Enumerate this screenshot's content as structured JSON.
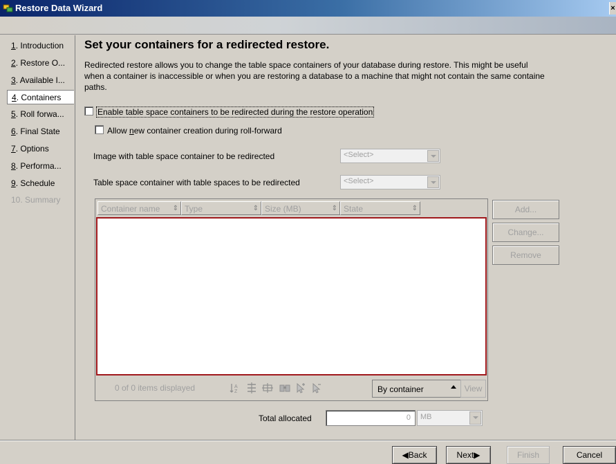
{
  "window": {
    "title": "Restore Data Wizard",
    "close_label": "×"
  },
  "steps": [
    {
      "label": "1. Introduction",
      "key": "1",
      "rest": ". Introduction",
      "state": "normal"
    },
    {
      "label": "2. Restore O...",
      "key": "2",
      "rest": ". Restore O...",
      "state": "normal"
    },
    {
      "label": "3. Available I...",
      "key": "3",
      "rest": ". Available I...",
      "state": "normal"
    },
    {
      "label": "4. Containers",
      "key": "4",
      "rest": ". Containers",
      "state": "active"
    },
    {
      "label": "5. Roll forwa...",
      "key": "5",
      "rest": ". Roll forwa...",
      "state": "normal"
    },
    {
      "label": "6. Final State",
      "key": "6",
      "rest": ". Final State",
      "state": "normal"
    },
    {
      "label": "7. Options",
      "key": "7",
      "rest": ". Options",
      "state": "normal"
    },
    {
      "label": "8. Performa...",
      "key": "8",
      "rest": ". Performa...",
      "state": "normal"
    },
    {
      "label": "9. Schedule",
      "key": "9",
      "rest": ". Schedule",
      "state": "normal"
    },
    {
      "label": "10. Summary",
      "key": "",
      "rest": "10. Summary",
      "state": "disabled"
    }
  ],
  "main": {
    "heading": "Set your containers for a redirected restore.",
    "description": "Redirected restore allows you to change the table space containers of your database during restore. This might be useful\nwhen a container is inaccessible or when you are restoring a database to a machine that might not contain the same containe\npaths.",
    "enable_redirect": {
      "label": "Enable table space containers to be redirected during the restore operation",
      "checked": false
    },
    "allow_new": {
      "label_pre": "Allow ",
      "label_key": "n",
      "label_post": "ew container creation during roll-forward",
      "checked": false
    },
    "image_field": {
      "label": "Image with table space container to be redirected",
      "value": "<Select>"
    },
    "tablespace_field": {
      "label": "Table space container with table spaces to be redirected",
      "value": "<Select>"
    }
  },
  "table": {
    "columns": [
      "Container name",
      "Type",
      "Size (MB)",
      "State"
    ],
    "rows": [],
    "count_text": "0 of 0 items displayed",
    "toolbar_icons": [
      "sort-icon",
      "filter-icon",
      "customize-columns-icon",
      "find-icon",
      "select-all-icon",
      "deselect-all-icon"
    ],
    "group_by": "By container",
    "view_label": "View"
  },
  "actions": {
    "add_label": "Add...",
    "change_label": "Change...",
    "remove_label": "Remove"
  },
  "total": {
    "label": "Total allocated",
    "value": "0",
    "unit": "MB"
  },
  "nav": {
    "back": "Back",
    "next": "Next",
    "finish": "Finish",
    "cancel": "Cancel"
  }
}
